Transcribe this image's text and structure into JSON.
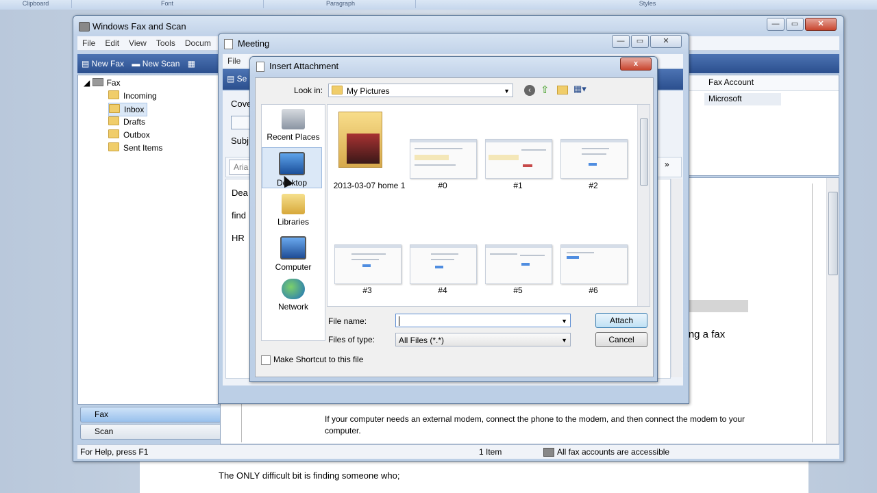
{
  "ribbon": {
    "groups": [
      "Clipboard",
      "Font",
      "Paragraph",
      "Styles"
    ]
  },
  "fax_window": {
    "title": "Windows Fax and Scan",
    "menu": [
      "File",
      "Edit",
      "View",
      "Tools",
      "Docum"
    ],
    "toolbar": {
      "new_fax": "New Fax",
      "new_scan": "New Scan"
    },
    "tree": {
      "root": "Fax",
      "items": [
        "Incoming",
        "Inbox",
        "Drafts",
        "Outbox",
        "Sent Items"
      ]
    },
    "columns": {
      "fax_account": "Fax Account",
      "account_value": "Microsoft"
    },
    "nav": {
      "fax": "Fax",
      "scan": "Scan"
    },
    "status": {
      "help": "For Help, press F1",
      "count": "1 Item",
      "accounts": "All fax accounts are accessible"
    },
    "preview": {
      "fax_text": "sing a fax",
      "modem_text": "If your computer needs an external modem, connect the phone to the modem, and then connect the modem to your computer.",
      "doc_text": "The ONLY difficult bit is finding someone who;"
    }
  },
  "meeting_window": {
    "title": "Meeting",
    "menu_file": "File",
    "toolbar_send": "Se",
    "cover": "Cove",
    "subject": "Subj",
    "font": "Aria",
    "body_lines": [
      "Dea",
      "find",
      "HR"
    ],
    "more": "»"
  },
  "dialog": {
    "title": "Insert Attachment",
    "look_in_label": "Look in:",
    "look_in_value": "My Pictures",
    "places": [
      "Recent Places",
      "Desktop",
      "Libraries",
      "Computer",
      "Network"
    ],
    "folder": "2013-03-07 home 1",
    "thumbnails": [
      "#0",
      "#1",
      "#2",
      "#3",
      "#4",
      "#5",
      "#6"
    ],
    "file_name_label": "File name:",
    "file_name_value": "",
    "files_of_type_label": "Files of type:",
    "files_of_type_value": "All Files (*.*)",
    "attach": "Attach",
    "cancel": "Cancel",
    "shortcut_label": "Make Shortcut to this file",
    "close_symbol": "x"
  },
  "icons": [
    "folder-icon",
    "fax-icon",
    "back-icon",
    "up-folder-icon",
    "new-folder-icon",
    "view-menu-icon",
    "recent-places-icon",
    "desktop-icon",
    "libraries-icon",
    "computer-icon",
    "network-icon",
    "mouse-cursor-icon"
  ],
  "colors": {
    "toolbar_blue": "#2b4f8e",
    "selection": "#dbe8f7",
    "close_red": "#c8452e"
  }
}
